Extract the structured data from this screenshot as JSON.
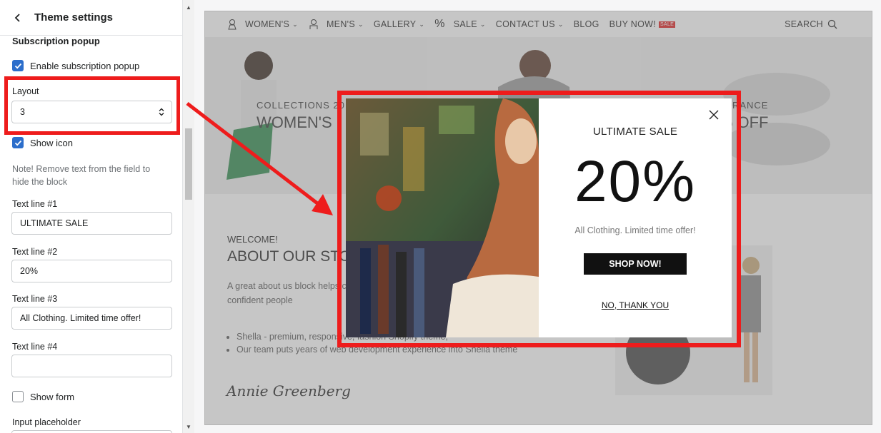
{
  "panel": {
    "title": "Theme settings",
    "section": "Subscription popup",
    "enable_popup_label": "Enable subscription popup",
    "layout_label": "Layout",
    "layout_value": "3",
    "show_icon_label": "Show icon",
    "note": "Note! Remove text from the field to hide the block",
    "text1_label": "Text line #1",
    "text1_value": "ULTIMATE SALE",
    "text2_label": "Text line #2",
    "text2_value": "20%",
    "text3_label": "Text line #3",
    "text3_value": "All Clothing. Limited time offer!",
    "text4_label": "Text line #4",
    "text4_value": "",
    "show_form_label": "Show form",
    "input_placeholder_label": "Input placeholder"
  },
  "store": {
    "nav": [
      "WOMEN'S",
      "MEN'S",
      "GALLERY",
      "SALE",
      "CONTACT US",
      "BLOG",
      "BUY NOW!"
    ],
    "sale_badge": "SALE",
    "search": "SEARCH",
    "hero_left_sub": "COLLECTIONS 20",
    "hero_left_title": "WOMEN'S",
    "hero_right_sub": "CLEARANCE",
    "hero_right_title": "% OFF",
    "welcome": "WELCOME!",
    "about_title": "ABOUT OUR STO",
    "about_body": "A great about us block helps customers. The more content the more confident people",
    "bullet1": "Shella - premium, responsive, fashion Shopify theme,",
    "bullet2": "Our team puts years of web development experience into Shella theme",
    "signature": "Annie Greenberg"
  },
  "popup": {
    "line1": "ULTIMATE SALE",
    "line2": "20%",
    "line3": "All Clothing. Limited time offer!",
    "button": "SHOP NOW!",
    "decline": "NO, THANK YOU"
  },
  "colors": {
    "accent": "#2c6ecb",
    "highlight": "#ee1c1c"
  }
}
